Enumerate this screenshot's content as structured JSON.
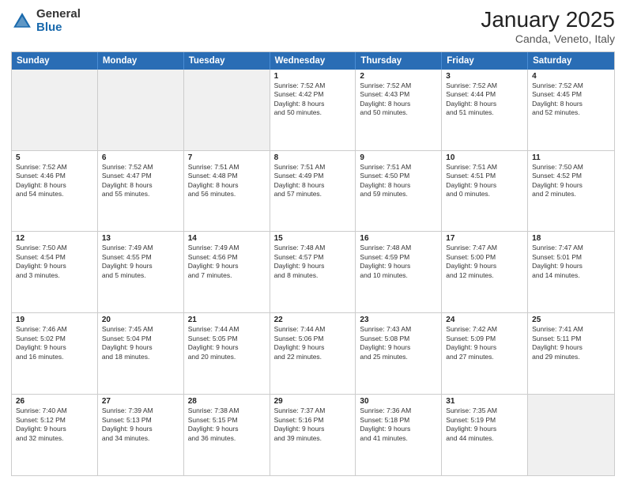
{
  "logo": {
    "general": "General",
    "blue": "Blue"
  },
  "title": "January 2025",
  "subtitle": "Canda, Veneto, Italy",
  "headers": [
    "Sunday",
    "Monday",
    "Tuesday",
    "Wednesday",
    "Thursday",
    "Friday",
    "Saturday"
  ],
  "weeks": [
    [
      {
        "day": "",
        "lines": [],
        "shaded": true
      },
      {
        "day": "",
        "lines": [],
        "shaded": true
      },
      {
        "day": "",
        "lines": [],
        "shaded": true
      },
      {
        "day": "1",
        "lines": [
          "Sunrise: 7:52 AM",
          "Sunset: 4:42 PM",
          "Daylight: 8 hours",
          "and 50 minutes."
        ]
      },
      {
        "day": "2",
        "lines": [
          "Sunrise: 7:52 AM",
          "Sunset: 4:43 PM",
          "Daylight: 8 hours",
          "and 50 minutes."
        ]
      },
      {
        "day": "3",
        "lines": [
          "Sunrise: 7:52 AM",
          "Sunset: 4:44 PM",
          "Daylight: 8 hours",
          "and 51 minutes."
        ]
      },
      {
        "day": "4",
        "lines": [
          "Sunrise: 7:52 AM",
          "Sunset: 4:45 PM",
          "Daylight: 8 hours",
          "and 52 minutes."
        ]
      }
    ],
    [
      {
        "day": "5",
        "lines": [
          "Sunrise: 7:52 AM",
          "Sunset: 4:46 PM",
          "Daylight: 8 hours",
          "and 54 minutes."
        ]
      },
      {
        "day": "6",
        "lines": [
          "Sunrise: 7:52 AM",
          "Sunset: 4:47 PM",
          "Daylight: 8 hours",
          "and 55 minutes."
        ]
      },
      {
        "day": "7",
        "lines": [
          "Sunrise: 7:51 AM",
          "Sunset: 4:48 PM",
          "Daylight: 8 hours",
          "and 56 minutes."
        ]
      },
      {
        "day": "8",
        "lines": [
          "Sunrise: 7:51 AM",
          "Sunset: 4:49 PM",
          "Daylight: 8 hours",
          "and 57 minutes."
        ]
      },
      {
        "day": "9",
        "lines": [
          "Sunrise: 7:51 AM",
          "Sunset: 4:50 PM",
          "Daylight: 8 hours",
          "and 59 minutes."
        ]
      },
      {
        "day": "10",
        "lines": [
          "Sunrise: 7:51 AM",
          "Sunset: 4:51 PM",
          "Daylight: 9 hours",
          "and 0 minutes."
        ]
      },
      {
        "day": "11",
        "lines": [
          "Sunrise: 7:50 AM",
          "Sunset: 4:52 PM",
          "Daylight: 9 hours",
          "and 2 minutes."
        ]
      }
    ],
    [
      {
        "day": "12",
        "lines": [
          "Sunrise: 7:50 AM",
          "Sunset: 4:54 PM",
          "Daylight: 9 hours",
          "and 3 minutes."
        ]
      },
      {
        "day": "13",
        "lines": [
          "Sunrise: 7:49 AM",
          "Sunset: 4:55 PM",
          "Daylight: 9 hours",
          "and 5 minutes."
        ]
      },
      {
        "day": "14",
        "lines": [
          "Sunrise: 7:49 AM",
          "Sunset: 4:56 PM",
          "Daylight: 9 hours",
          "and 7 minutes."
        ]
      },
      {
        "day": "15",
        "lines": [
          "Sunrise: 7:48 AM",
          "Sunset: 4:57 PM",
          "Daylight: 9 hours",
          "and 8 minutes."
        ]
      },
      {
        "day": "16",
        "lines": [
          "Sunrise: 7:48 AM",
          "Sunset: 4:59 PM",
          "Daylight: 9 hours",
          "and 10 minutes."
        ]
      },
      {
        "day": "17",
        "lines": [
          "Sunrise: 7:47 AM",
          "Sunset: 5:00 PM",
          "Daylight: 9 hours",
          "and 12 minutes."
        ]
      },
      {
        "day": "18",
        "lines": [
          "Sunrise: 7:47 AM",
          "Sunset: 5:01 PM",
          "Daylight: 9 hours",
          "and 14 minutes."
        ]
      }
    ],
    [
      {
        "day": "19",
        "lines": [
          "Sunrise: 7:46 AM",
          "Sunset: 5:02 PM",
          "Daylight: 9 hours",
          "and 16 minutes."
        ]
      },
      {
        "day": "20",
        "lines": [
          "Sunrise: 7:45 AM",
          "Sunset: 5:04 PM",
          "Daylight: 9 hours",
          "and 18 minutes."
        ]
      },
      {
        "day": "21",
        "lines": [
          "Sunrise: 7:44 AM",
          "Sunset: 5:05 PM",
          "Daylight: 9 hours",
          "and 20 minutes."
        ]
      },
      {
        "day": "22",
        "lines": [
          "Sunrise: 7:44 AM",
          "Sunset: 5:06 PM",
          "Daylight: 9 hours",
          "and 22 minutes."
        ]
      },
      {
        "day": "23",
        "lines": [
          "Sunrise: 7:43 AM",
          "Sunset: 5:08 PM",
          "Daylight: 9 hours",
          "and 25 minutes."
        ]
      },
      {
        "day": "24",
        "lines": [
          "Sunrise: 7:42 AM",
          "Sunset: 5:09 PM",
          "Daylight: 9 hours",
          "and 27 minutes."
        ]
      },
      {
        "day": "25",
        "lines": [
          "Sunrise: 7:41 AM",
          "Sunset: 5:11 PM",
          "Daylight: 9 hours",
          "and 29 minutes."
        ]
      }
    ],
    [
      {
        "day": "26",
        "lines": [
          "Sunrise: 7:40 AM",
          "Sunset: 5:12 PM",
          "Daylight: 9 hours",
          "and 32 minutes."
        ]
      },
      {
        "day": "27",
        "lines": [
          "Sunrise: 7:39 AM",
          "Sunset: 5:13 PM",
          "Daylight: 9 hours",
          "and 34 minutes."
        ]
      },
      {
        "day": "28",
        "lines": [
          "Sunrise: 7:38 AM",
          "Sunset: 5:15 PM",
          "Daylight: 9 hours",
          "and 36 minutes."
        ]
      },
      {
        "day": "29",
        "lines": [
          "Sunrise: 7:37 AM",
          "Sunset: 5:16 PM",
          "Daylight: 9 hours",
          "and 39 minutes."
        ]
      },
      {
        "day": "30",
        "lines": [
          "Sunrise: 7:36 AM",
          "Sunset: 5:18 PM",
          "Daylight: 9 hours",
          "and 41 minutes."
        ]
      },
      {
        "day": "31",
        "lines": [
          "Sunrise: 7:35 AM",
          "Sunset: 5:19 PM",
          "Daylight: 9 hours",
          "and 44 minutes."
        ]
      },
      {
        "day": "",
        "lines": [],
        "shaded": true
      }
    ]
  ]
}
